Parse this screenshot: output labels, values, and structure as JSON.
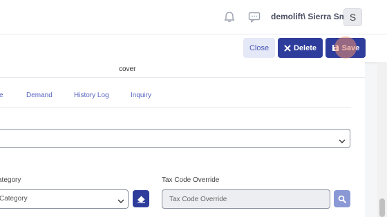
{
  "header": {
    "user_name": "demolift\\ Sierra Smith",
    "avatar_letter": "S",
    "icons": [
      "bell-icon",
      "chat-icon"
    ]
  },
  "toolbar": {
    "close_label": "Close",
    "delete_label": "Delete",
    "save_label": "Save"
  },
  "section": {
    "caption": "cover"
  },
  "tabs": [
    {
      "label": "e"
    },
    {
      "label": "Demand"
    },
    {
      "label": "History Log"
    },
    {
      "label": "Inquiry"
    }
  ],
  "form": {
    "category_label": "ategory",
    "category_value": "Category",
    "tax_label": "Tax Code Override",
    "tax_placeholder": "Tax Code Override"
  },
  "colors": {
    "primary": "#2e3c9c",
    "link": "#5563c1",
    "search_button": "#8a99d6"
  }
}
